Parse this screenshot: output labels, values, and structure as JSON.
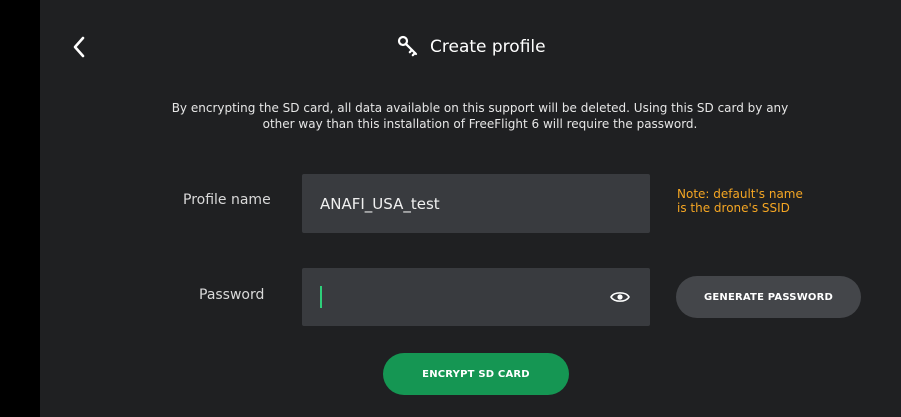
{
  "header": {
    "title": "Create profile",
    "icon": "key-icon",
    "back_icon": "chevron-left-icon"
  },
  "description": {
    "line1": "By encrypting the SD card, all data available on this support will be deleted. Using this SD card by any",
    "line2": "other way than this installation of FreeFlight 6 will require the password."
  },
  "profile": {
    "label": "Profile name",
    "value": "ANAFI_USA_test",
    "note_line1": "Note: default's name",
    "note_line2": "is the drone's SSID"
  },
  "password": {
    "label": "Password",
    "value": "",
    "toggle_icon": "eye-icon",
    "generate_label": "GENERATE PASSWORD"
  },
  "actions": {
    "encrypt_label": "ENCRYPT SD CARD"
  },
  "colors": {
    "background": "#1f2022",
    "field": "#393b3f",
    "accent_green": "#159653",
    "caret_green": "#2ecf7a",
    "note_orange": "#f5a623"
  }
}
